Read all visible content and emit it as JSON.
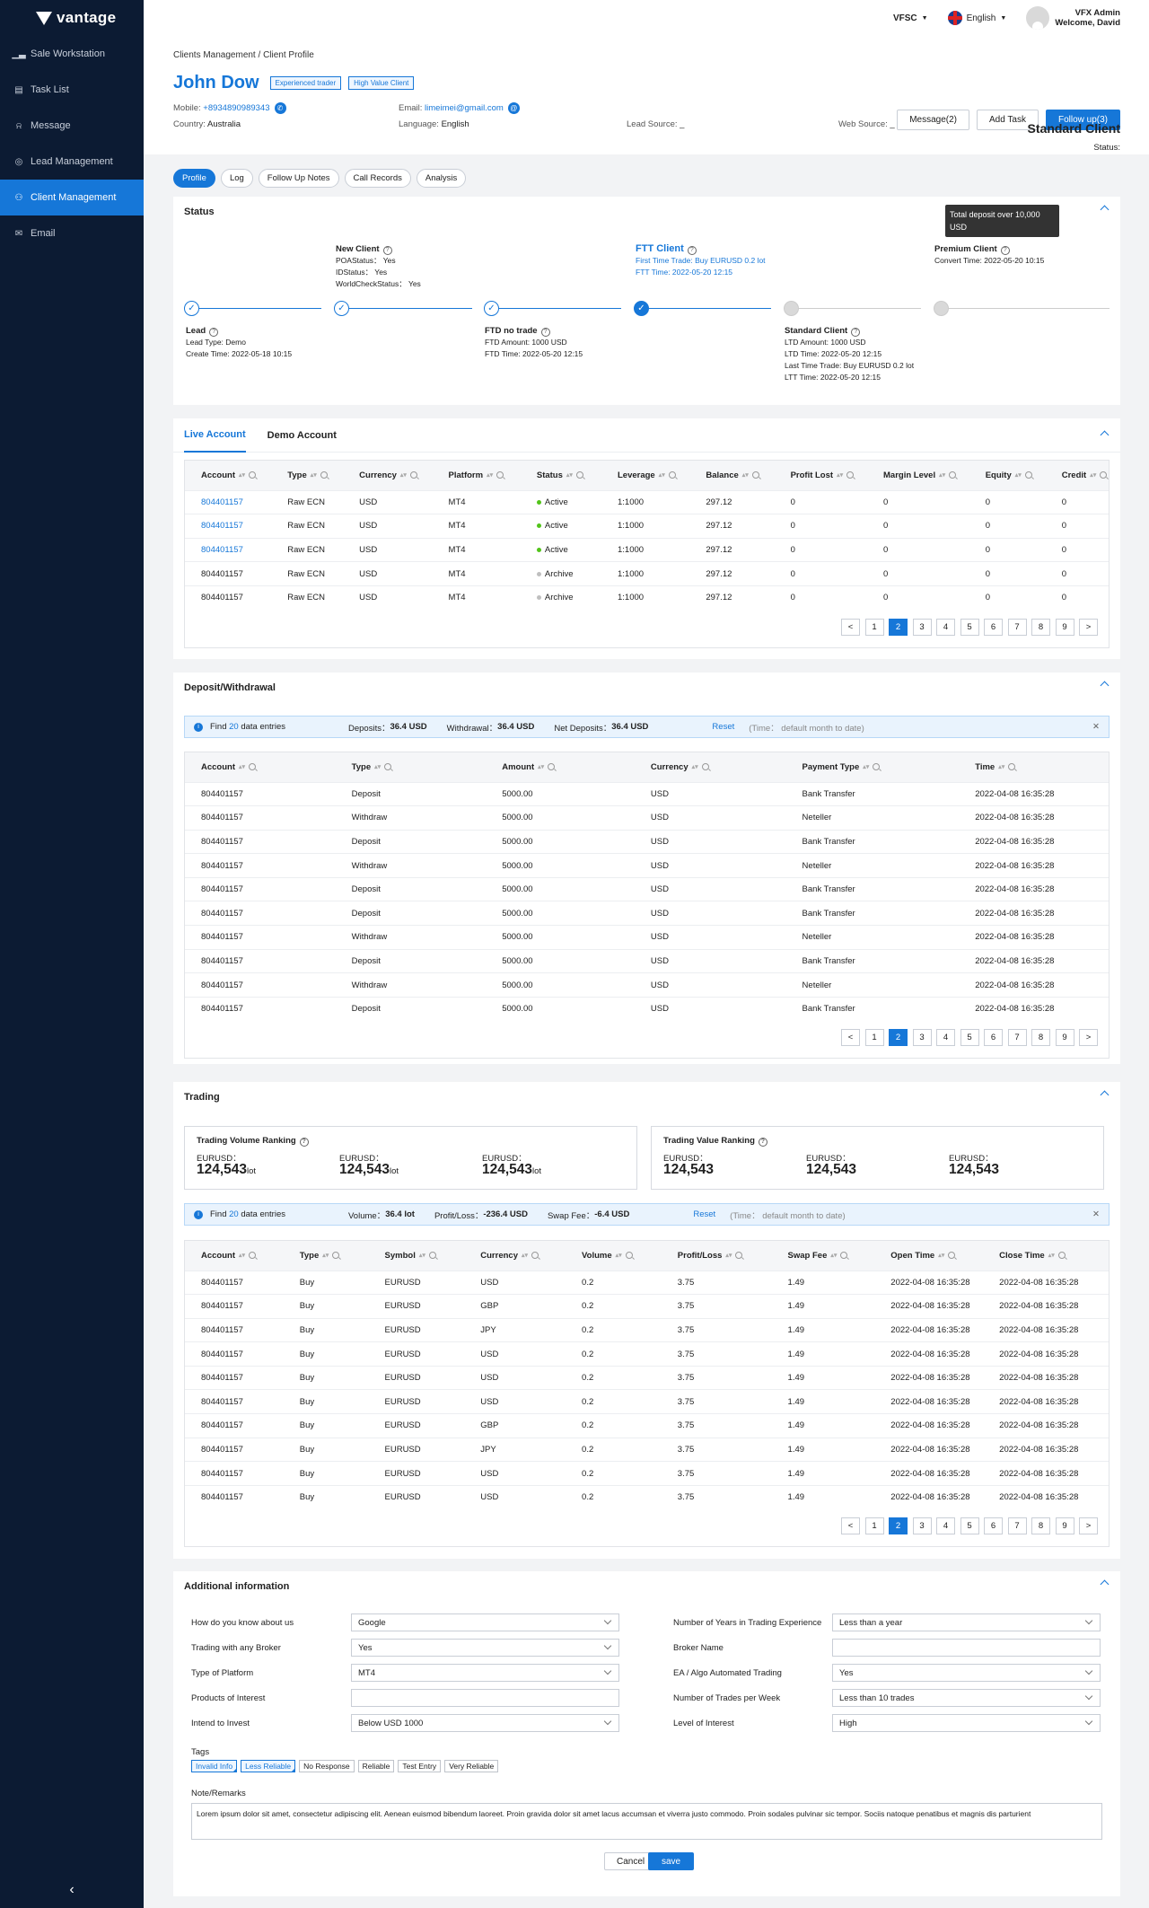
{
  "brand": "vantage",
  "nav": [
    {
      "label": "Sale Workstation",
      "icon": "bar-chart-icon"
    },
    {
      "label": "Task List",
      "icon": "document-icon"
    },
    {
      "label": "Message",
      "icon": "bell-icon"
    },
    {
      "label": "Lead Management",
      "icon": "lead-icon"
    },
    {
      "label": "Client Management",
      "icon": "users-icon",
      "active": true
    },
    {
      "label": "Email",
      "icon": "mail-icon"
    }
  ],
  "topbar": {
    "entity": "VFSC",
    "language": "English",
    "user_line1": "VFX Admin",
    "user_line2": "Welcome, David"
  },
  "breadcrumb": {
    "parent": "Clients Management",
    "sep": "/",
    "current": "Client Profile"
  },
  "client": {
    "name": "John Dow",
    "tags": [
      "Experienced trader",
      "High Value Client"
    ],
    "mobile_label": "Mobile:",
    "mobile": "+8934890989343",
    "email_label": "Email:",
    "email": "limeimei@gmail.com",
    "country_label": "Country:",
    "country": "Australia",
    "language_label": "Language:",
    "language": "English",
    "lead_source_label": "Lead Source:",
    "lead_source": "_",
    "web_source_label": "Web Source:",
    "web_source": "_",
    "status_label": "Status:",
    "status_value": "Standard Client"
  },
  "actions": {
    "message": "Message(2)",
    "add_task": "Add Task",
    "follow_up": "Follow up(3)"
  },
  "tabs": [
    "Profile",
    "Log",
    "Follow Up Notes",
    "Call Records",
    "Analysis"
  ],
  "status": {
    "title": "Status",
    "new_client": {
      "title": "New Client",
      "lines": [
        "POAStatus： Yes",
        "IDStatus： Yes",
        "WorldCheckStatus： Yes"
      ]
    },
    "ftt_client": {
      "title": "FTT Client",
      "lines": [
        "First Time Trade: Buy EURUSD  0.2 lot",
        "FTT Time: 2022-05-20 12:15"
      ]
    },
    "premium_client": {
      "title": "Premium Client",
      "lines": [
        "Convert Time: 2022-05-20 10:15"
      ]
    },
    "tooltip": "Total deposit over 10,000 USD",
    "lead": {
      "title": "Lead",
      "lines": [
        "Lead Type: Demo",
        "Create Time: 2022-05-18 10:15"
      ]
    },
    "ftd": {
      "title": "FTD no trade",
      "lines": [
        "FTD Amount: 1000 USD",
        "FTD Time: 2022-05-20 12:15"
      ]
    },
    "standard": {
      "title": "Standard Client",
      "lines": [
        "LTD Amount: 1000 USD",
        "LTD Time: 2022-05-20 12:15",
        "Last Time Trade: Buy EURUSD  0.2 lot",
        "LTT Time: 2022-05-20 12:15"
      ]
    }
  },
  "accounts": {
    "tabs": [
      "Live Account",
      "Demo Account"
    ],
    "columns": [
      "Account",
      "Type",
      "Currency",
      "Platform",
      "Status",
      "Leverage",
      "Balance",
      "Profit Lost",
      "Margin Level",
      "Equity",
      "Credit"
    ],
    "rows": [
      [
        "804401157",
        "Raw ECN",
        "USD",
        "MT4",
        "Active",
        "1:1000",
        "297.12",
        "0",
        "0",
        "0",
        "0"
      ],
      [
        "804401157",
        "Raw ECN",
        "USD",
        "MT4",
        "Active",
        "1:1000",
        "297.12",
        "0",
        "0",
        "0",
        "0"
      ],
      [
        "804401157",
        "Raw ECN",
        "USD",
        "MT4",
        "Active",
        "1:1000",
        "297.12",
        "0",
        "0",
        "0",
        "0"
      ],
      [
        "804401157",
        "Raw ECN",
        "USD",
        "MT4",
        "Archive",
        "1:1000",
        "297.12",
        "0",
        "0",
        "0",
        "0"
      ],
      [
        "804401157",
        "Raw ECN",
        "USD",
        "MT4",
        "Archive",
        "1:1000",
        "297.12",
        "0",
        "0",
        "0",
        "0"
      ]
    ],
    "linked_rows": [
      true,
      true,
      true,
      false,
      false
    ]
  },
  "pager": {
    "pages": [
      "1",
      "2",
      "3",
      "4",
      "5",
      "6",
      "7",
      "8",
      "9"
    ],
    "current": "2",
    "prev": "<",
    "next": ">"
  },
  "deposit": {
    "title": "Deposit/Withdrawal",
    "info": {
      "find": "Find",
      "count": "20",
      "entries": "data entries",
      "deposits_label": "Deposits：",
      "deposits": "36.4 USD",
      "withdrawal_label": "Withdrawal：",
      "withdrawal": "36.4 USD",
      "net_label": "Net Deposits：",
      "net": "36.4 USD",
      "reset": "Reset",
      "time_note": "(Time： default month to date)"
    },
    "columns": [
      "Account",
      "Type",
      "Amount",
      "Currency",
      "Payment Type",
      "Time"
    ],
    "rows": [
      [
        "804401157",
        "Deposit",
        "5000.00",
        "USD",
        "Bank Transfer",
        "2022-04-08 16:35:28"
      ],
      [
        "804401157",
        "Withdraw",
        "5000.00",
        "USD",
        "Neteller",
        "2022-04-08 16:35:28"
      ],
      [
        "804401157",
        "Deposit",
        "5000.00",
        "USD",
        "Bank Transfer",
        "2022-04-08 16:35:28"
      ],
      [
        "804401157",
        "Withdraw",
        "5000.00",
        "USD",
        "Neteller",
        "2022-04-08 16:35:28"
      ],
      [
        "804401157",
        "Deposit",
        "5000.00",
        "USD",
        "Bank Transfer",
        "2022-04-08 16:35:28"
      ],
      [
        "804401157",
        "Deposit",
        "5000.00",
        "USD",
        "Bank Transfer",
        "2022-04-08 16:35:28"
      ],
      [
        "804401157",
        "Withdraw",
        "5000.00",
        "USD",
        "Neteller",
        "2022-04-08 16:35:28"
      ],
      [
        "804401157",
        "Deposit",
        "5000.00",
        "USD",
        "Bank Transfer",
        "2022-04-08 16:35:28"
      ],
      [
        "804401157",
        "Withdraw",
        "5000.00",
        "USD",
        "Neteller",
        "2022-04-08 16:35:28"
      ],
      [
        "804401157",
        "Deposit",
        "5000.00",
        "USD",
        "Bank Transfer",
        "2022-04-08 16:35:28"
      ]
    ]
  },
  "trading": {
    "title": "Trading",
    "volume_ranking": {
      "title": "Trading Volume Ranking",
      "items": [
        {
          "label": "EURUSD：",
          "value": "124,543",
          "unit": "lot"
        },
        {
          "label": "EURUSD：",
          "value": "124,543",
          "unit": "lot"
        },
        {
          "label": "EURUSD：",
          "value": "124,543",
          "unit": "lot"
        }
      ]
    },
    "value_ranking": {
      "title": "Trading Value Ranking",
      "items": [
        {
          "label": "EURUSD：",
          "value": "124,543"
        },
        {
          "label": "EURUSD：",
          "value": "124,543"
        },
        {
          "label": "EURUSD：",
          "value": "124,543"
        }
      ]
    },
    "info": {
      "find": "Find",
      "count": "20",
      "entries": "data entries",
      "volume_label": "Volume：",
      "volume": "36.4 lot",
      "pl_label": "Profit/Loss：",
      "pl": "-236.4 USD",
      "swap_label": "Swap Fee：",
      "swap": "-6.4 USD",
      "reset": "Reset",
      "time_note": "(Time： default month to date)"
    },
    "columns": [
      "Account",
      "Type",
      "Symbol",
      "Currency",
      "Volume",
      "Profit/Loss",
      "Swap Fee",
      "Open Time",
      "Close Time"
    ],
    "rows": [
      [
        "804401157",
        "Buy",
        "EURUSD",
        "USD",
        "0.2",
        "3.75",
        "1.49",
        "2022-04-08 16:35:28",
        "2022-04-08 16:35:28"
      ],
      [
        "804401157",
        "Buy",
        "EURUSD",
        "GBP",
        "0.2",
        "3.75",
        "1.49",
        "2022-04-08 16:35:28",
        "2022-04-08 16:35:28"
      ],
      [
        "804401157",
        "Buy",
        "EURUSD",
        "JPY",
        "0.2",
        "3.75",
        "1.49",
        "2022-04-08 16:35:28",
        "2022-04-08 16:35:28"
      ],
      [
        "804401157",
        "Buy",
        "EURUSD",
        "USD",
        "0.2",
        "3.75",
        "1.49",
        "2022-04-08 16:35:28",
        "2022-04-08 16:35:28"
      ],
      [
        "804401157",
        "Buy",
        "EURUSD",
        "USD",
        "0.2",
        "3.75",
        "1.49",
        "2022-04-08 16:35:28",
        "2022-04-08 16:35:28"
      ],
      [
        "804401157",
        "Buy",
        "EURUSD",
        "USD",
        "0.2",
        "3.75",
        "1.49",
        "2022-04-08 16:35:28",
        "2022-04-08 16:35:28"
      ],
      [
        "804401157",
        "Buy",
        "EURUSD",
        "GBP",
        "0.2",
        "3.75",
        "1.49",
        "2022-04-08 16:35:28",
        "2022-04-08 16:35:28"
      ],
      [
        "804401157",
        "Buy",
        "EURUSD",
        "JPY",
        "0.2",
        "3.75",
        "1.49",
        "2022-04-08 16:35:28",
        "2022-04-08 16:35:28"
      ],
      [
        "804401157",
        "Buy",
        "EURUSD",
        "USD",
        "0.2",
        "3.75",
        "1.49",
        "2022-04-08 16:35:28",
        "2022-04-08 16:35:28"
      ],
      [
        "804401157",
        "Buy",
        "EURUSD",
        "USD",
        "0.2",
        "3.75",
        "1.49",
        "2022-04-08 16:35:28",
        "2022-04-08 16:35:28"
      ]
    ]
  },
  "additional": {
    "title": "Additional information",
    "left": [
      {
        "label": "How do you know about us",
        "value": "Google",
        "type": "select"
      },
      {
        "label": "Trading with any Broker",
        "value": "Yes",
        "type": "select"
      },
      {
        "label": "Type of Platform",
        "value": "MT4",
        "type": "select"
      },
      {
        "label": "Products of Interest",
        "value": "",
        "type": "input"
      },
      {
        "label": "Intend to Invest",
        "value": "Below USD 1000",
        "type": "select"
      }
    ],
    "right": [
      {
        "label": "Number of Years in Trading Experience",
        "value": "Less than a year",
        "type": "select"
      },
      {
        "label": "Broker Name",
        "value": "",
        "type": "input"
      },
      {
        "label": "EA / Algo Automated Trading",
        "value": "Yes",
        "type": "select"
      },
      {
        "label": "Number of Trades per Week",
        "value": "Less than 10 trades",
        "type": "select"
      },
      {
        "label": "Level of Interest",
        "value": "High",
        "type": "select"
      }
    ],
    "tags_label": "Tags",
    "tags": [
      {
        "label": "Invalid Info",
        "selected": true
      },
      {
        "label": "Less Reliable",
        "selected": true
      },
      {
        "label": "No Response",
        "selected": false
      },
      {
        "label": "Reliable",
        "selected": false
      },
      {
        "label": "Test Entry",
        "selected": false
      },
      {
        "label": "Very Reliable",
        "selected": false
      }
    ],
    "notes_label": "Note/Remarks",
    "notes": "Lorem ipsum dolor sit amet, consectetur adipiscing elit. Aenean euismod bibendum laoreet. Proin gravida dolor sit amet lacus accumsan et viverra justo commodo. Proin sodales pulvinar sic tempor. Sociis natoque penatibus et magnis dis parturient",
    "cancel": "Cancel",
    "save": "save"
  },
  "colors": {
    "primary": "#1677d8",
    "sidebar": "#0c1b33",
    "active_dot": "#52c41a",
    "archive_dot": "#bfbfbf"
  }
}
